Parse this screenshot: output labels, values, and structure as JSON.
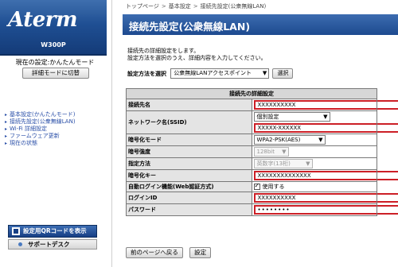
{
  "brand": {
    "logo": "Aterm",
    "model": "W300P"
  },
  "sidebar": {
    "mode_text": "現在の設定:かんたんモード",
    "mode_button": "詳細モードに切替",
    "items": [
      {
        "label": "基本設定(かんたんモード)"
      },
      {
        "label": "接続先設定(公衆無線LAN)"
      },
      {
        "label": "Wi-Fi 詳細設定"
      },
      {
        "label": "ファームウェア更新"
      },
      {
        "label": "現在の状態"
      }
    ],
    "qr_button": "設定用QRコードを表示",
    "support_button": "サポートデスク"
  },
  "breadcrumb": [
    "トップページ",
    "基本設定",
    "接続先設定(公衆無線LAN)"
  ],
  "page_title": "接続先設定(公衆無線LAN)",
  "description": {
    "line1": "接続先の詳細設定をします。",
    "line2": "設定方法を選択のうえ、詳細内容を入力してください。"
  },
  "method": {
    "label": "設定方法を選択",
    "selected": "公衆無線LANアクセスポイント",
    "select_button": "選択"
  },
  "table": {
    "header": "接続先の詳細設定",
    "rows": {
      "connection_name": {
        "label": "接続先名",
        "value": "XXXXXXXXXX"
      },
      "ssid": {
        "label": "ネットワーク名(SSID)",
        "mode": "個別設定",
        "value": "XXXXX-XXXXXX"
      },
      "encryption_mode": {
        "label": "暗号化モード",
        "value": "WPA2-PSK(AES)"
      },
      "encryption_strength": {
        "label": "暗号強度",
        "value": "128bit"
      },
      "key_method": {
        "label": "指定方法",
        "value": "英数字(13桁)"
      },
      "encryption_key": {
        "label": "暗号化キー",
        "value": "XXXXXXXXXXXXXX"
      },
      "auto_login": {
        "label": "自動ログイン機能(Web認証方式)",
        "option": "使用する",
        "checked": true
      },
      "login_id": {
        "label": "ログインID",
        "value": "XXXXXXXXXX"
      },
      "password": {
        "label": "パスワード",
        "value": "••••••••"
      }
    }
  },
  "buttons": {
    "back": "前のページへ戻る",
    "apply": "設定"
  }
}
